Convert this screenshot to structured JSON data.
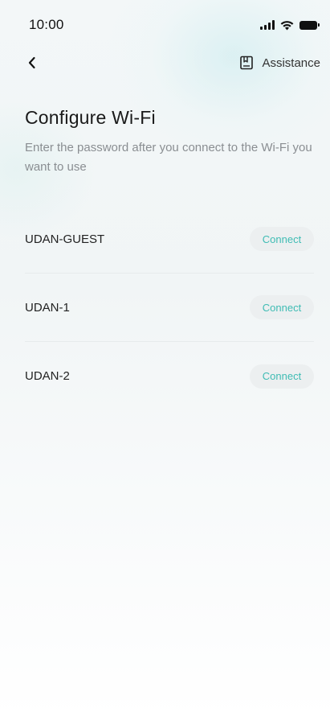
{
  "status_bar": {
    "time": "10:00"
  },
  "nav": {
    "back_icon": "chevron-left-icon",
    "assistance_icon": "book-icon",
    "assistance_label": "Assistance"
  },
  "page": {
    "title": "Configure Wi-Fi",
    "description": "Enter the password after you connect to the Wi-Fi you want to use"
  },
  "networks": [
    {
      "ssid": "UDAN-GUEST",
      "action": "Connect"
    },
    {
      "ssid": "UDAN-1",
      "action": "Connect"
    },
    {
      "ssid": "UDAN-2",
      "action": "Connect"
    }
  ],
  "colors": {
    "accent": "#3fbcb4",
    "button_bg": "#eceff0",
    "text_primary": "#1a1a1a",
    "text_secondary": "#8a8e92"
  }
}
